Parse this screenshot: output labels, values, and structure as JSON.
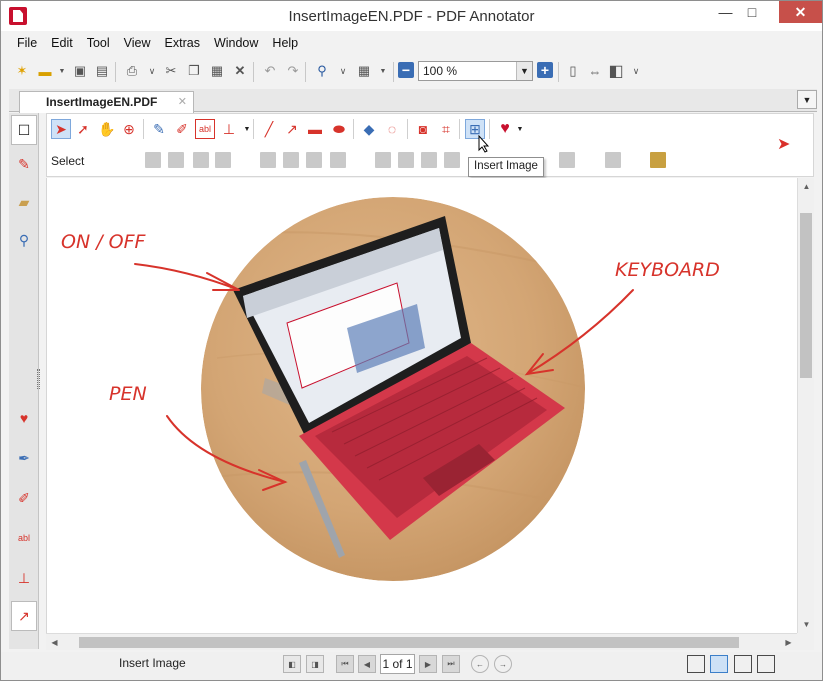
{
  "window": {
    "title": "InsertImageEN.PDF - PDF Annotator",
    "minimize": "—",
    "maximize": "□",
    "close": "✕"
  },
  "menu": [
    "File",
    "Edit",
    "Tool",
    "View",
    "Extras",
    "Window",
    "Help"
  ],
  "toolbar": {
    "zoom_value": "100 %",
    "icons": [
      "new-icon",
      "open-icon",
      "save-icon",
      "save-as-icon",
      "print-icon",
      "cut-icon",
      "copy-icon",
      "paste-icon",
      "delete-icon",
      "undo-icon",
      "redo-icon",
      "find-icon",
      "grid-icon",
      "zoom-out-icon",
      "zoom-in-icon",
      "fit-page-icon",
      "fit-width-icon",
      "fullscreen-icon"
    ]
  },
  "tabs": [
    {
      "label": "InsertImageEN.PDF",
      "close": "✕"
    }
  ],
  "annotation_toolbar": {
    "select_label": "Select",
    "tooltip": "Insert Image"
  },
  "page": {
    "annotations": [
      "ON / OFF",
      "KEYBOARD",
      "PEN"
    ]
  },
  "statusbar": {
    "status_text": "Insert Image",
    "page_indicator": "1 of 1"
  },
  "colors": {
    "accent_red": "#c8102e",
    "ink_red": "#d7332b",
    "selection_blue": "#cfe2f7"
  }
}
